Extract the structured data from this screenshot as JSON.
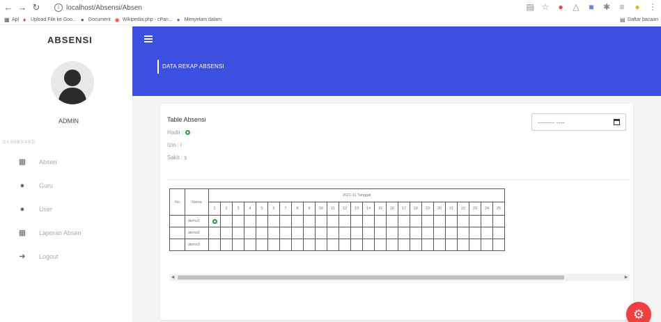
{
  "browser": {
    "url": "localhost/Absensi/Absen",
    "bookmarks": [
      "Apl",
      "Upload File ke Goo...",
      "Document",
      "Wikipedia.php - cPan...",
      "Menyelam dalam"
    ],
    "bookmarks_right": "Daftar bacaan"
  },
  "sidebar": {
    "brand": "ABSENSI",
    "user": "ADMIN",
    "section": "DASHBOARD",
    "items": [
      {
        "label": "Absen",
        "icon": "calendar-icon"
      },
      {
        "label": "Guru",
        "icon": "user-icon"
      },
      {
        "label": "User",
        "icon": "user-icon"
      },
      {
        "label": "Laporan Absen",
        "icon": "calendar-icon"
      },
      {
        "label": "Logout",
        "icon": "logout-icon"
      }
    ]
  },
  "header": {
    "page_title": "DATA REKAP ABSENSI"
  },
  "card": {
    "title": "Table Absensi",
    "hadir_label": "Hadir :",
    "izin_label": "Izin :",
    "izin_value": "i",
    "sakit_label": "Sakit :",
    "sakit_value": "s",
    "date_placeholder": "-------- ----"
  },
  "table": {
    "col_no": "No",
    "col_nama": "Nama",
    "month_header": "2021-11 Tanggal",
    "days": [
      "1",
      "2",
      "3",
      "4",
      "5",
      "6",
      "7",
      "8",
      "9",
      "10",
      "11",
      "12",
      "13",
      "14",
      "15",
      "16",
      "17",
      "18",
      "19",
      "20",
      "21",
      "22",
      "23",
      "24",
      "25"
    ],
    "rows": [
      {
        "no": "",
        "name": "demo1",
        "present": [
          "1"
        ]
      },
      {
        "no": "",
        "name": "demo2",
        "present": []
      },
      {
        "no": "",
        "name": "demo3",
        "present": []
      }
    ]
  },
  "colors": {
    "banner": "#3d4fe0",
    "present_dot": "#1e9e3a",
    "fab": "#ef3f3f"
  }
}
